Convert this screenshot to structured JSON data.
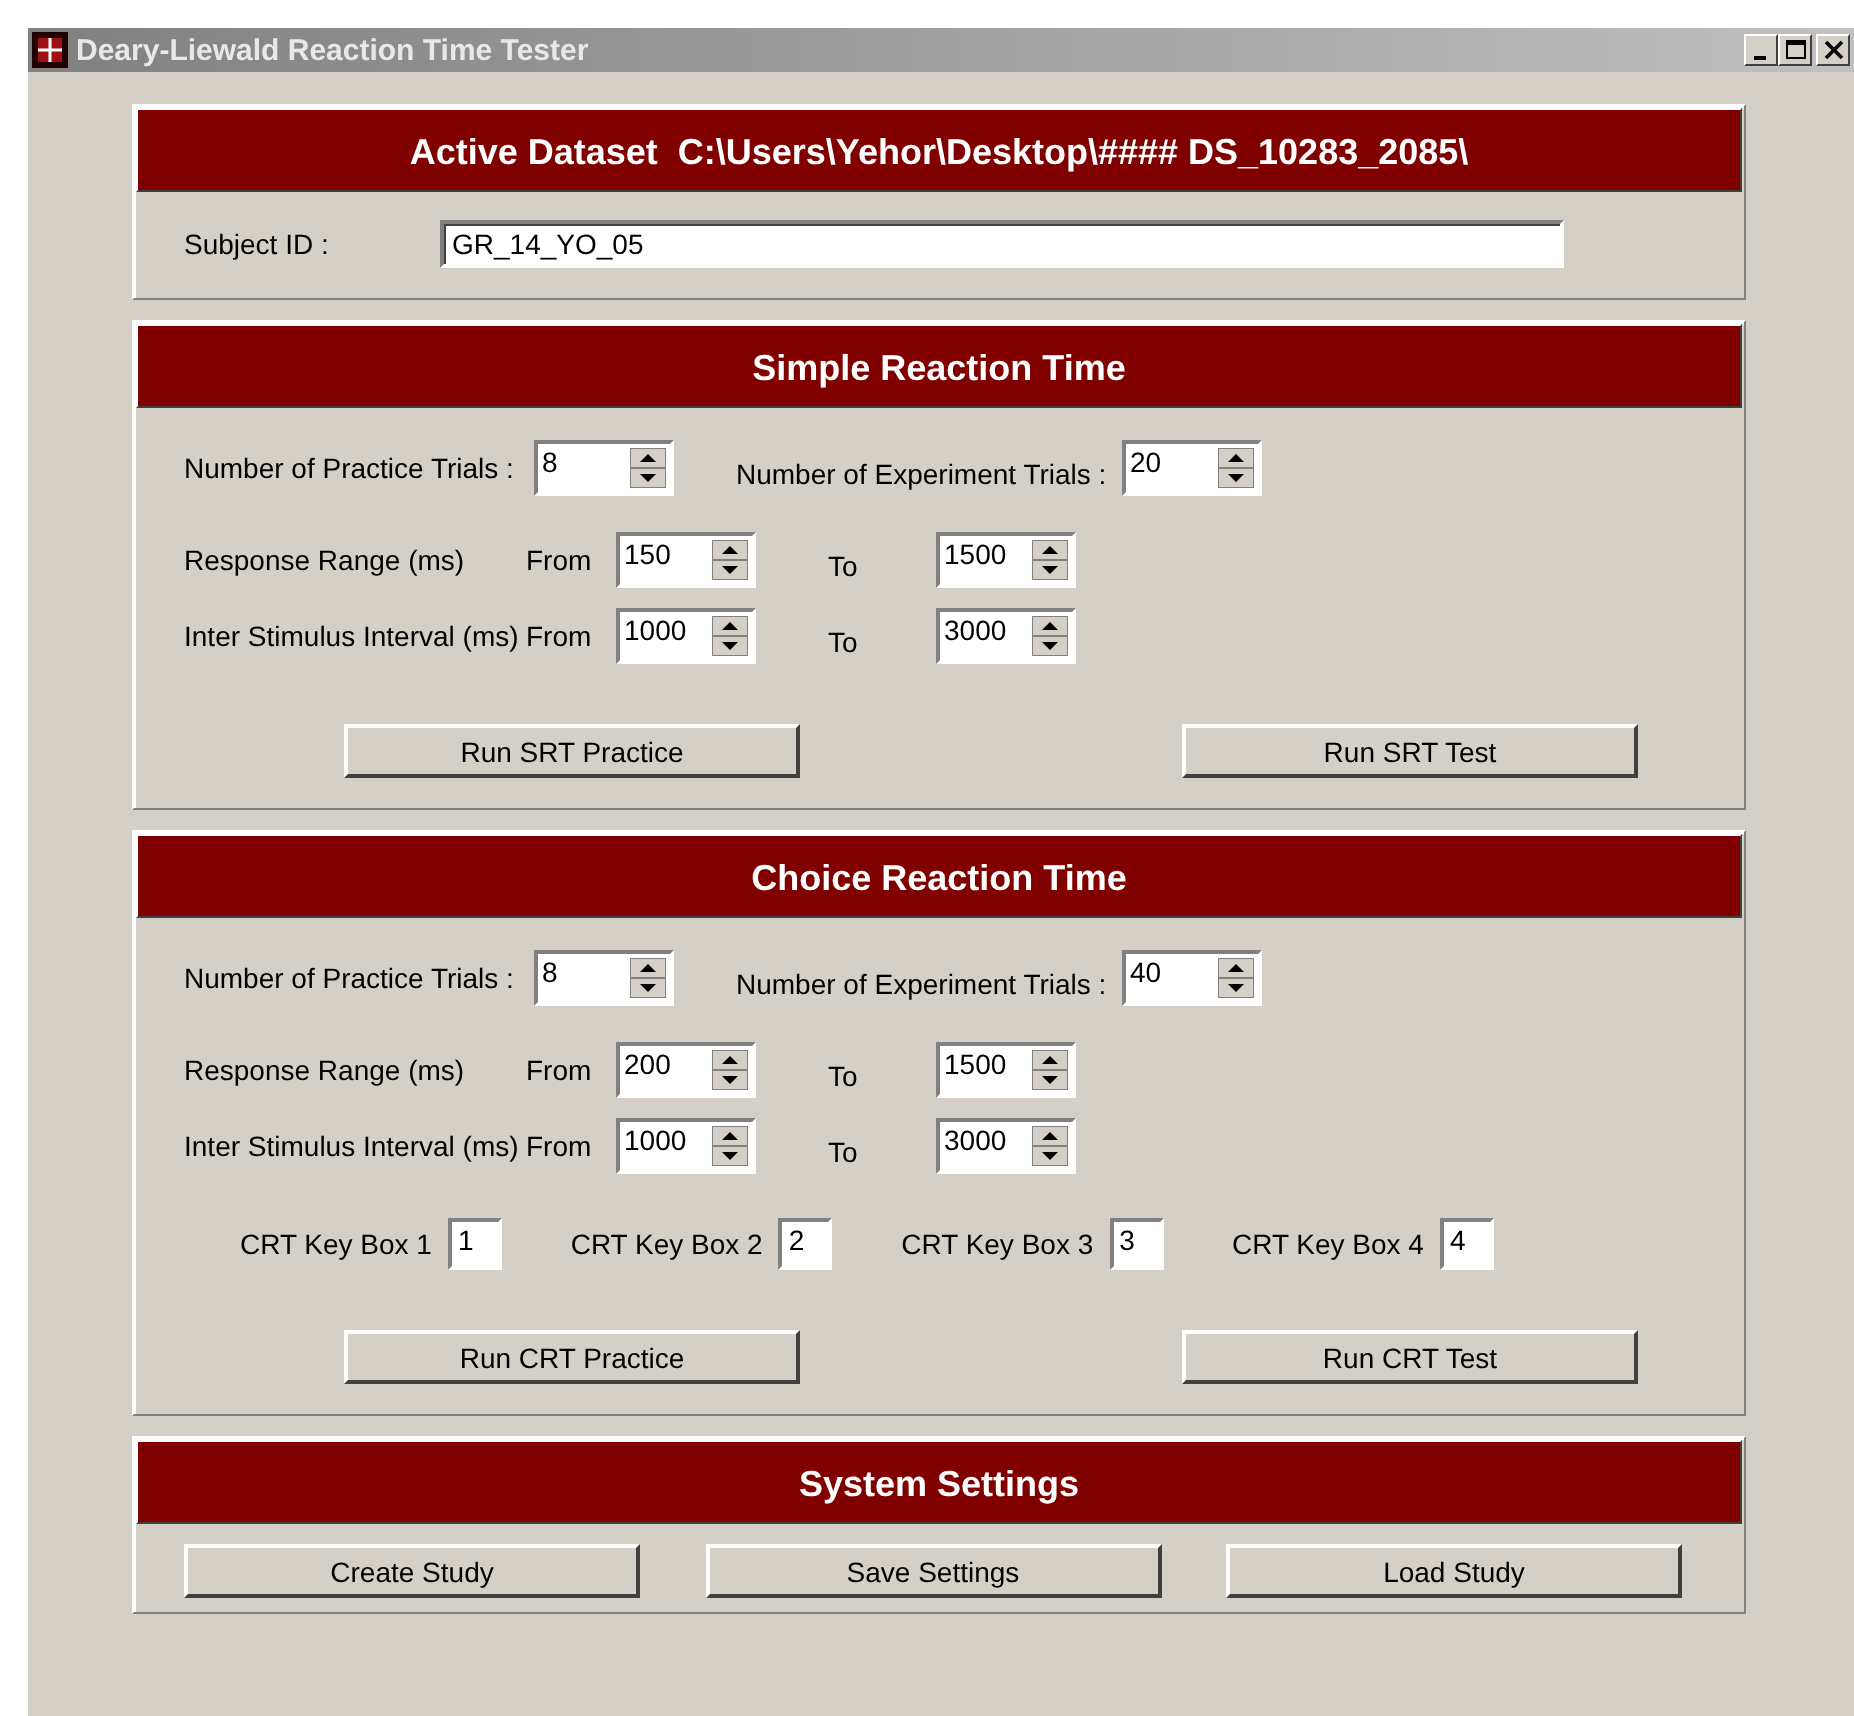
{
  "window": {
    "title": "Deary-Liewald Reaction Time Tester"
  },
  "dataset": {
    "header": "Active Dataset  C:\\Users\\Yehor\\Desktop\\#### DS_10283_2085\\",
    "subject_label": "Subject ID :",
    "subject_value": "GR_14_YO_05"
  },
  "sections": [
    {
      "title": "Simple Reaction Time",
      "practice": {
        "label": "Number of Practice Trials :",
        "value": "8"
      },
      "experiment": {
        "label": "Number of Experiment Trials :",
        "value": "20"
      },
      "ranges": [
        {
          "label": "Response Range (ms)",
          "from_label": "From",
          "from": "150",
          "to_label": "To",
          "to": "1500"
        },
        {
          "label": "Inter Stimulus Interval (ms)",
          "from_label": "From",
          "from": "1000",
          "to_label": "To",
          "to": "3000"
        }
      ],
      "buttons": [
        "Run SRT Practice",
        "Run SRT Test"
      ]
    },
    {
      "title": "Choice Reaction Time",
      "practice": {
        "label": "Number of Practice Trials :",
        "value": "8"
      },
      "experiment": {
        "label": "Number of Experiment Trials :",
        "value": "40"
      },
      "ranges": [
        {
          "label": "Response Range (ms)",
          "from_label": "From",
          "from": "200",
          "to_label": "To",
          "to": "1500"
        },
        {
          "label": "Inter Stimulus Interval (ms)",
          "from_label": "From",
          "from": "1000",
          "to_label": "To",
          "to": "3000"
        }
      ],
      "key_boxes": [
        {
          "label": "CRT Key Box 1",
          "value": "1"
        },
        {
          "label": "CRT Key Box 2",
          "value": "2"
        },
        {
          "label": "CRT Key Box 3",
          "value": "3"
        },
        {
          "label": "CRT Key Box 4",
          "value": "4"
        }
      ],
      "buttons": [
        "Run CRT Practice",
        "Run CRT Test"
      ]
    }
  ],
  "system": {
    "title": "System Settings",
    "buttons": [
      "Create Study",
      "Save Settings",
      "Load Study"
    ]
  }
}
